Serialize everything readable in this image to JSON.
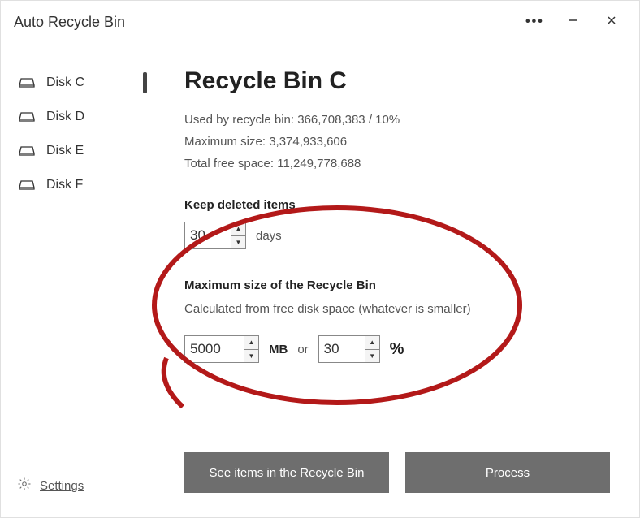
{
  "app_title": "Auto Recycle Bin",
  "sidebar": {
    "items": [
      {
        "label": "Disk C",
        "active": true
      },
      {
        "label": "Disk D",
        "active": false
      },
      {
        "label": "Disk E",
        "active": false
      },
      {
        "label": "Disk F",
        "active": false
      }
    ],
    "settings_label": "Settings"
  },
  "main": {
    "title": "Recycle Bin C",
    "used_label": "Used by recycle bin:",
    "used_value": "366,708,383 / 10%",
    "max_label": "Maximum size:",
    "max_value": "3,374,933,606",
    "free_label": "Total free space:",
    "free_value": "11,249,778,688",
    "keep_section": "Keep deleted items",
    "keep_days_value": "30",
    "keep_days_unit": "days",
    "maxsize_section": "Maximum size of the Recycle Bin",
    "maxsize_subtext": "Calculated from free disk space (whatever is smaller)",
    "max_mb_value": "5000",
    "max_mb_unit": "MB",
    "or_label": "or",
    "max_pct_value": "30",
    "max_pct_unit": "%",
    "button_see_items": "See items in the Recycle Bin",
    "button_process": "Process"
  },
  "annotation": {
    "color": "#b31919"
  }
}
